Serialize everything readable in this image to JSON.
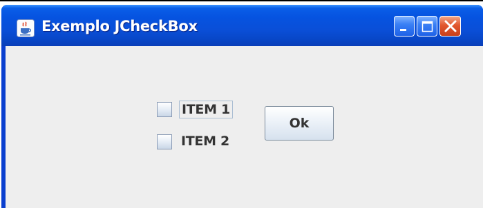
{
  "window": {
    "title": "Exemplo JCheckBox",
    "app_icon": "java-cup-icon",
    "controls": [
      "minimize-icon",
      "maximize-icon",
      "close-icon"
    ]
  },
  "content": {
    "checkboxes": [
      {
        "label": "ITEM 1",
        "checked": false,
        "focused": true
      },
      {
        "label": "ITEM 2",
        "checked": false,
        "focused": false
      }
    ],
    "ok_button_label": "Ok"
  },
  "colors": {
    "title_bar": "#0a4fd8",
    "client_background": "#eeeeee",
    "close_button": "#e2572e"
  }
}
